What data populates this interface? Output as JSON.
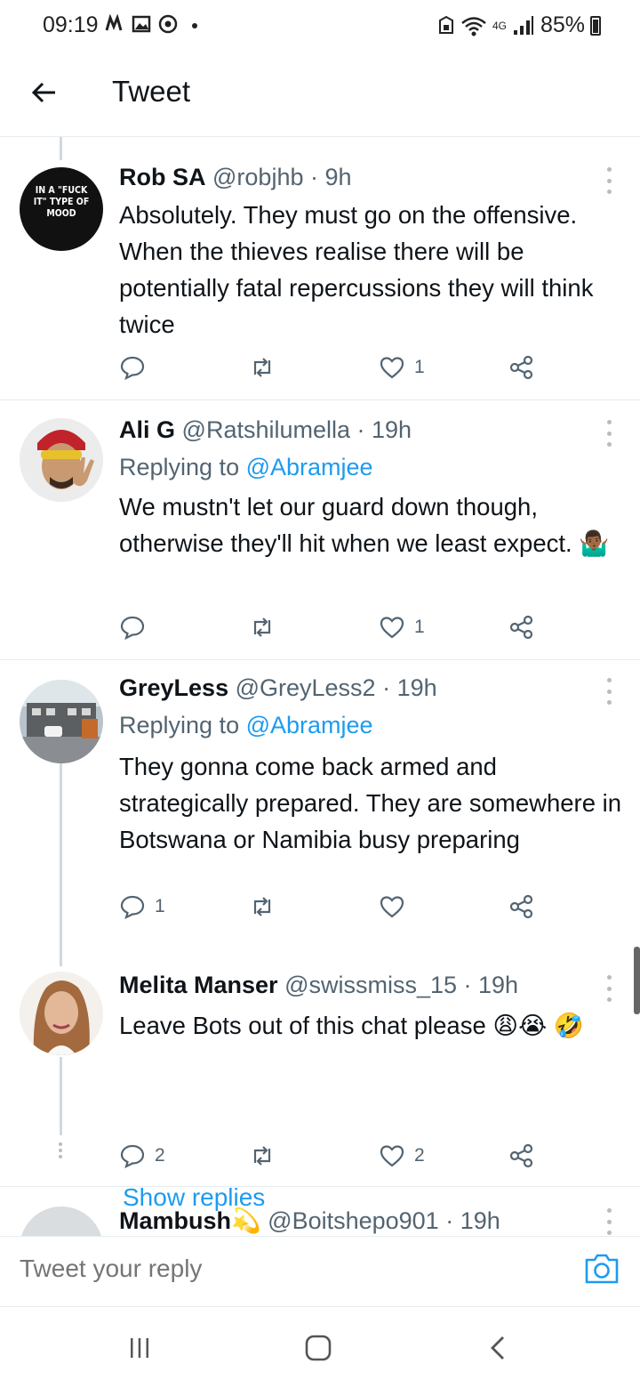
{
  "status_bar": {
    "time": "09:19",
    "battery": "85%",
    "network": "4G"
  },
  "header": {
    "title": "Tweet"
  },
  "tweets": [
    {
      "name": "Rob SA",
      "meta": "@robjhb · 9h",
      "avatar_text": "IN A \"FUCK IT\" TYPE OF MOOD",
      "replying_to": "",
      "text": "Absolutely. They must go on the offensive. When the thieves realise there will be potentially fatal repercussions they will think twice",
      "replies": "",
      "likes": "1"
    },
    {
      "name": "Ali G",
      "meta": "@Ratshilumella · 19h",
      "replying_prefix": "Replying to ",
      "replying_to": "@Abramjee",
      "text": "We mustn't let our guard down though, otherwise they'll hit when we least expect. 🤷🏾‍♂️",
      "replies": "",
      "likes": "1"
    },
    {
      "name": "GreyLess",
      "meta": "@GreyLess2 · 19h",
      "replying_prefix": "Replying to ",
      "replying_to": "@Abramjee",
      "text": "They gonna come back armed and strategically prepared. They are somewhere in Botswana or Namibia busy preparing",
      "replies": "1",
      "likes": ""
    },
    {
      "name": "Melita Manser",
      "meta": "@swissmiss_15 · 19h",
      "replying_to": "",
      "text": "Leave Bots out of this chat please 😩😭 🤣",
      "replies": "2",
      "likes": "2"
    },
    {
      "name": "Mambush💫",
      "meta": "@Boitshepo901 · 19h"
    }
  ],
  "show_replies": "Show replies",
  "reply_bar": {
    "placeholder": "Tweet your reply"
  },
  "icons": {
    "back": "arrow-left-icon",
    "reply": "comment-icon",
    "retweet": "retweet-icon",
    "like": "heart-icon",
    "share": "share-icon",
    "camera": "camera-icon"
  },
  "colors": {
    "accent": "#1d9bf0",
    "text": "#0f1419",
    "muted": "#536471",
    "divider": "#e6ecf0"
  }
}
